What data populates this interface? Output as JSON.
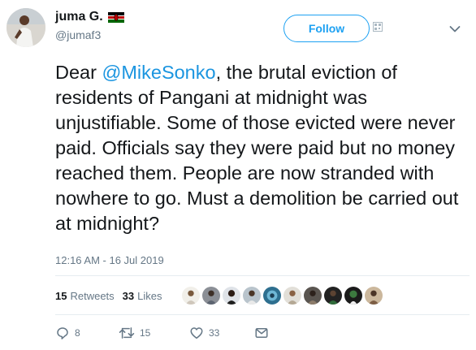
{
  "author": {
    "display_name": "juma G.",
    "handle": "@jumaf3",
    "avatar_icon": "avatar-photo",
    "flag_icon": "kenya-flag-icon"
  },
  "follow_button": {
    "label": "Follow"
  },
  "tweet": {
    "text_before": "Dear ",
    "mention": "@MikeSonko",
    "text_after": ", the brutal eviction of residents of Pangani at midnight was unjustifiable. Some of those evicted were never paid. Officials say they were paid but no money reached them. People are now stranded with nowhere to go. Must a demolition be carried out at midnight?",
    "timestamp": "12:16 AM - 16 Jul 2019"
  },
  "stats": {
    "retweets_count": "15",
    "retweets_label": "Retweets",
    "likes_count": "33",
    "likes_label": "Likes",
    "liker_avatar_count": 10
  },
  "actions": {
    "reply_count": "8",
    "retweet_count": "15",
    "like_count": "33"
  },
  "colors": {
    "accent": "#1da1f2",
    "mention": "#1b95e0",
    "secondary_text": "#657786",
    "primary_text": "#14171a",
    "divider": "#e6ecf0"
  }
}
